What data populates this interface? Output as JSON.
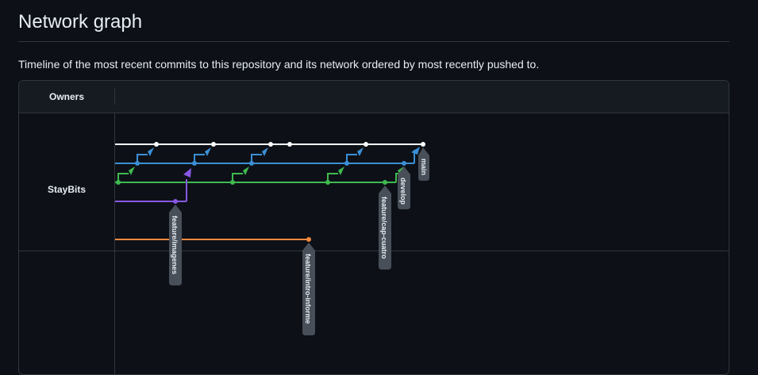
{
  "page": {
    "title": "Network graph",
    "description": "Timeline of the most recent commits to this repository and its network ordered by most recently pushed to."
  },
  "graph": {
    "owners_header": "Owners",
    "owners": [
      {
        "name": "StayBits"
      }
    ],
    "colors": {
      "main": "#ffffff",
      "develop": "#3b8fd6",
      "feature-cap-cuatro": "#3fb950",
      "feature-imagenes": "#8957e5",
      "feature-intro-informe": "#f0883e",
      "label_bg": "#484f58"
    },
    "branches": [
      {
        "key": "main",
        "label": "main"
      },
      {
        "key": "develop",
        "label": "develop"
      },
      {
        "key": "feature-cap-cuatro",
        "label": "feature/cap-cuatro"
      },
      {
        "key": "feature-imagenes",
        "label": "feature/imagenes"
      },
      {
        "key": "feature-intro-informe",
        "label": "feature/intro-informe"
      }
    ]
  }
}
